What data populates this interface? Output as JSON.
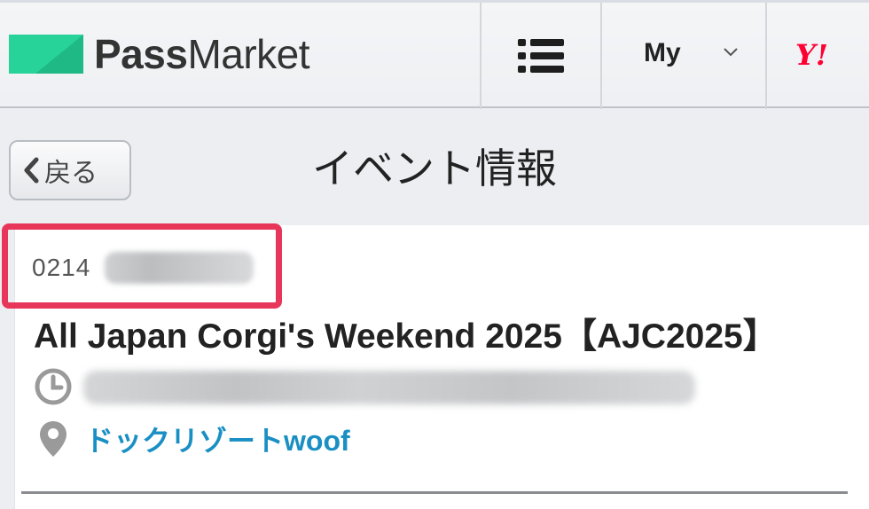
{
  "header": {
    "logo_text_bold": "Pass",
    "logo_text_light": "Market",
    "logo_color": "#28d39a",
    "menu_icon": "hamburger-icon",
    "my_label": "My",
    "my_caret_icon": "chevron-down-icon",
    "yahoo_label": "Y!"
  },
  "title_bar": {
    "back_label": "戻る",
    "back_icon": "chevron-left-icon",
    "title": "イベント情報"
  },
  "event": {
    "id_visible": "0214",
    "title": "All Japan Corgi's Weekend 2025【AJC2025】",
    "date_icon": "clock-icon",
    "venue_icon": "map-pin-icon",
    "venue": "ドックリゾートwoof"
  },
  "colors": {
    "highlight": "#e8365a",
    "link": "#1a8fc4",
    "yahoo": "#ff0033"
  }
}
